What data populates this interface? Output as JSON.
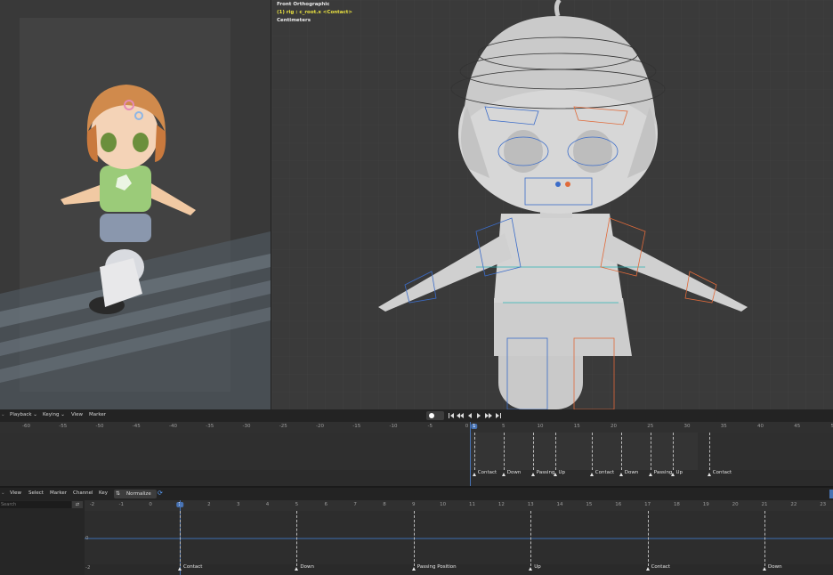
{
  "viewport": {
    "view_name": "Front Orthographic",
    "selection": "(1) rig : c_root.x <Contact>",
    "units": "Centimeters"
  },
  "dopesheet": {
    "menu": [
      "Playback",
      "Keying",
      "View",
      "Marker"
    ],
    "ruler_ticks": [
      "-60",
      "-55",
      "-50",
      "-45",
      "-40",
      "-35",
      "-30",
      "-25",
      "-20",
      "-15",
      "-10",
      "-5",
      "0",
      "1",
      "5",
      "10",
      "15",
      "20",
      "25",
      "30",
      "35",
      "40",
      "45",
      "50"
    ],
    "current_frame": "1",
    "markers": [
      "Contact",
      "Down",
      "Passing",
      "Up",
      "Contact",
      "Down",
      "Passing",
      "Up",
      "Contact"
    ]
  },
  "graph_editor": {
    "menu": [
      "View",
      "Select",
      "Marker",
      "Channel",
      "Key"
    ],
    "normalize_label": "Normalize",
    "search_placeholder": "Search",
    "ruler_ticks": [
      "-2",
      "-1",
      "0",
      "1",
      "2",
      "3",
      "4",
      "5",
      "6",
      "7",
      "8",
      "9",
      "10",
      "11",
      "12",
      "13",
      "14",
      "15",
      "16",
      "17",
      "18",
      "19",
      "20",
      "21",
      "22",
      "23"
    ],
    "current_frame": "1",
    "value_axis": [
      "0",
      "-2"
    ],
    "markers": [
      "Contact",
      "Down",
      "Passing Position",
      "Up",
      "Contact",
      "Down"
    ]
  }
}
